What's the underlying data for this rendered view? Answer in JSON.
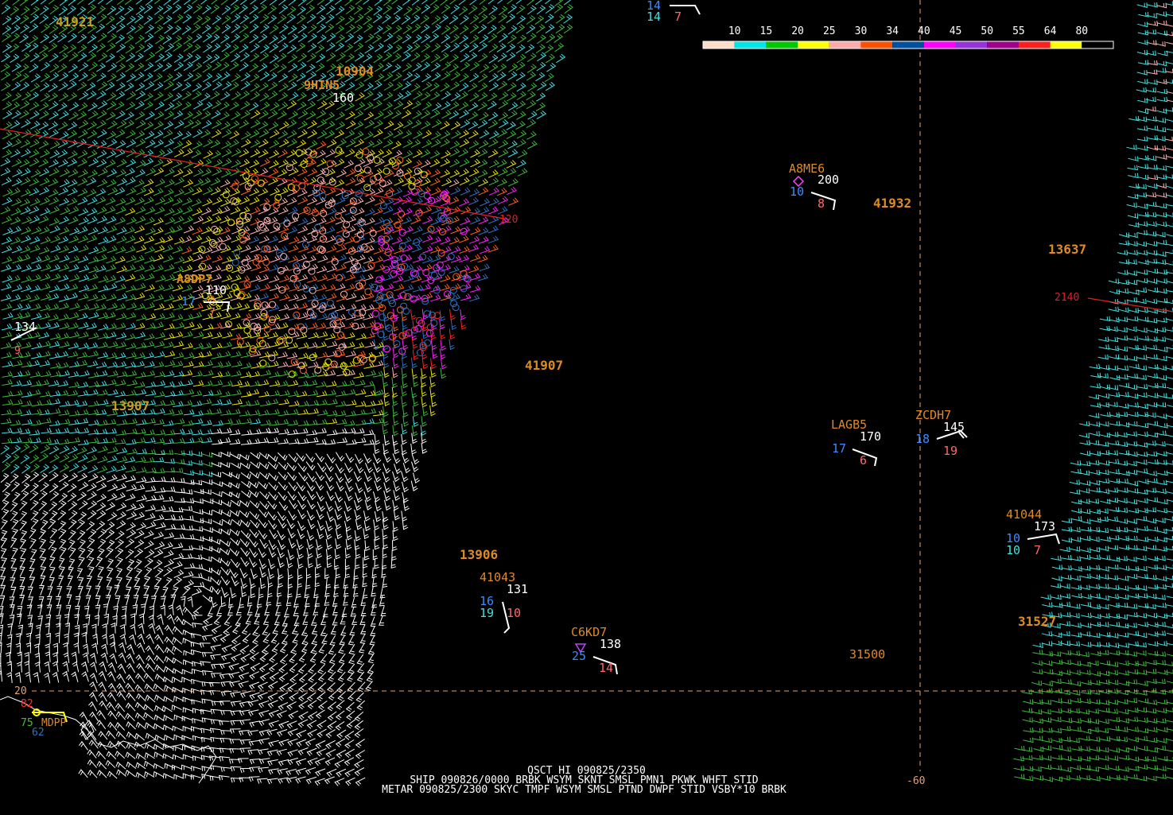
{
  "header": {
    "line1": "QSCT HI 090825/2350",
    "line2": "SHIP 090826/0000  BRBK WSYM SKNT SMSL PMN1 PKWK WHFT STID",
    "line3": "METAR 090825/2300  SKYC TMPF WSYM SMSL PTND DWPF STID VSBY*10 BRBK"
  },
  "legend": {
    "labels": [
      "10",
      "15",
      "20",
      "25",
      "30",
      "34",
      "40",
      "45",
      "50",
      "55",
      "64",
      "80"
    ],
    "colors": [
      "#ffdcc8",
      "#00e6e6",
      "#00c800",
      "#ffff00",
      "#ffaaaa",
      "#ff5000",
      "#0050a0",
      "#ff00ff",
      "#9632dc",
      "#a0008c",
      "#ff1e1e",
      "#ffff00",
      "#000000"
    ]
  },
  "grid": {
    "lat_label": "20",
    "lon_label": "-60",
    "line_color": "#e8a070"
  },
  "colors": {
    "wind_cyan": "#40e0e0",
    "wind_green": "#3cb83c",
    "wind_yellow": "#e6e600",
    "wind_pink": "#ffb4b4",
    "wind_orange": "#ff6020",
    "wind_blue": "#3070c0",
    "wind_magenta": "#ff20ff",
    "wind_red": "#ff2020",
    "wind_white": "#ffffff",
    "station_id": "#e08a20",
    "pressure": "#ffffff",
    "dewpoint_blue": "#3a8cff",
    "speed_cyan": "#40e0e0",
    "wave_pink": "#ff6868",
    "track_red": "#e02020"
  },
  "stations": [
    {
      "id": "A8ME6",
      "pressure": "200",
      "speed": "10",
      "waves": "8"
    },
    {
      "id": "LAGB5",
      "pressure": "170",
      "speed": "17",
      "waves": "6"
    },
    {
      "id": "ZCDH7",
      "pressure": "145",
      "speed": "18",
      "waves": "19"
    },
    {
      "id": "41044",
      "pressure": "173",
      "speed": "10",
      "speed2": "10",
      "waves": "7"
    },
    {
      "id": "41043",
      "pressure": "131",
      "speed": "16",
      "speed2": "19",
      "waves": "10"
    },
    {
      "id": "C6KD7",
      "pressure": "138",
      "speed": "25",
      "waves": "14"
    }
  ],
  "top_station": {
    "speed": "14",
    "speed2": "14",
    "waves": "7"
  },
  "ids": {
    "s41921": "41921",
    "s10904": "10904",
    "s9hin5": "9HIN5",
    "p160": "160",
    "s41932": "41932",
    "s13637": "13637",
    "s41907": "41907",
    "s13907": "13907",
    "s13906": "13906",
    "s31527": "31527",
    "s31500": "31500",
    "trk2140": "2140",
    "trk120": "120",
    "p134": "134",
    "w9": "9",
    "left_id": "A8DP7",
    "left_p": "110",
    "left_s": "17",
    "left_w": "7"
  },
  "metar": {
    "id": "MDPP",
    "temp": "82",
    "dew": "75",
    "extra": "62"
  }
}
